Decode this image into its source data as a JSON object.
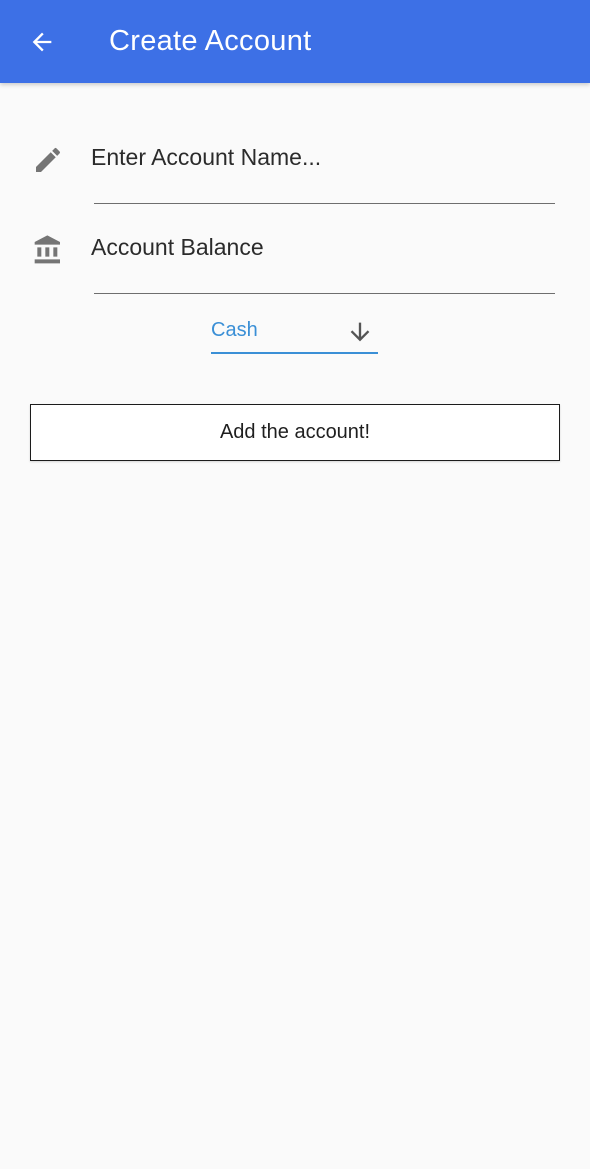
{
  "appbar": {
    "title": "Create Account",
    "back_icon": "arrow-left-icon",
    "color": "#3d70e6"
  },
  "form": {
    "account_name": {
      "icon": "pencil-icon",
      "placeholder": "Enter Account Name...",
      "value": ""
    },
    "account_balance": {
      "icon": "bank-icon",
      "placeholder": "Account Balance",
      "value": ""
    },
    "account_type": {
      "selected": "Cash",
      "icon": "arrow-down-icon",
      "accent": "#3a8fd6"
    }
  },
  "actions": {
    "add_label": "Add the account!"
  }
}
